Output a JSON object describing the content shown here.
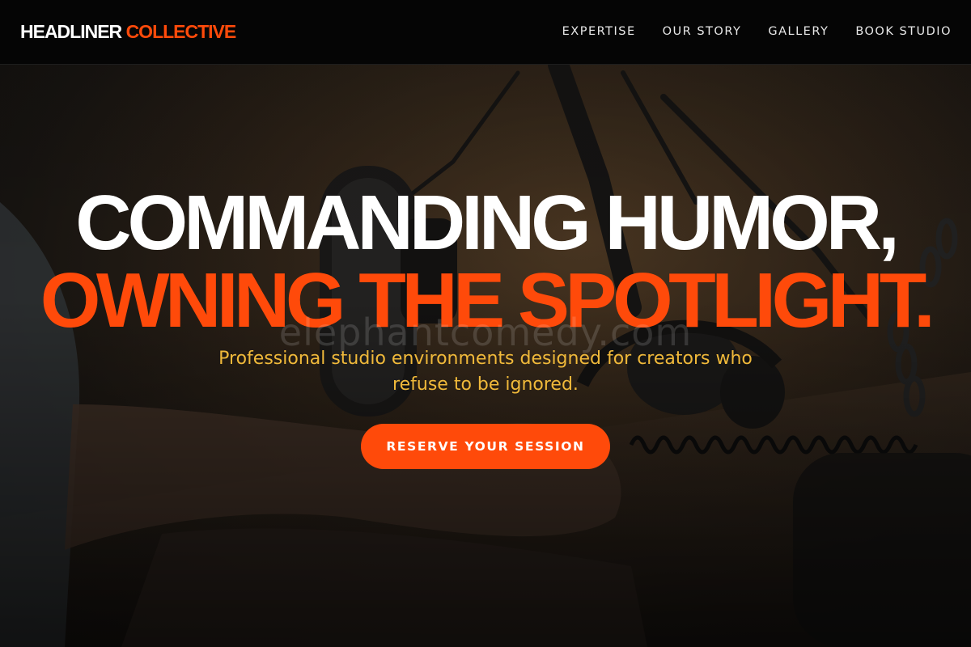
{
  "brand": {
    "name_part1": "HEADLINER",
    "name_part2": "COLLECTIVE",
    "accent_color": "#ff4a0a",
    "subtitle_color": "#f0b93a"
  },
  "nav": {
    "items": [
      {
        "label": "EXPERTISE"
      },
      {
        "label": "OUR STORY"
      },
      {
        "label": "GALLERY"
      },
      {
        "label": "BOOK STUDIO"
      }
    ]
  },
  "hero": {
    "headline_line1": "COMMANDING HUMOR,",
    "headline_line2": "OWNING THE SPOTLIGHT.",
    "watermark": "elephantcomedy.com",
    "subtitle": "Professional studio environments designed for creators who refuse to be ignored.",
    "cta_label": "RESERVE YOUR SESSION",
    "background_image": "podcast-microphone-headphones-photo"
  }
}
